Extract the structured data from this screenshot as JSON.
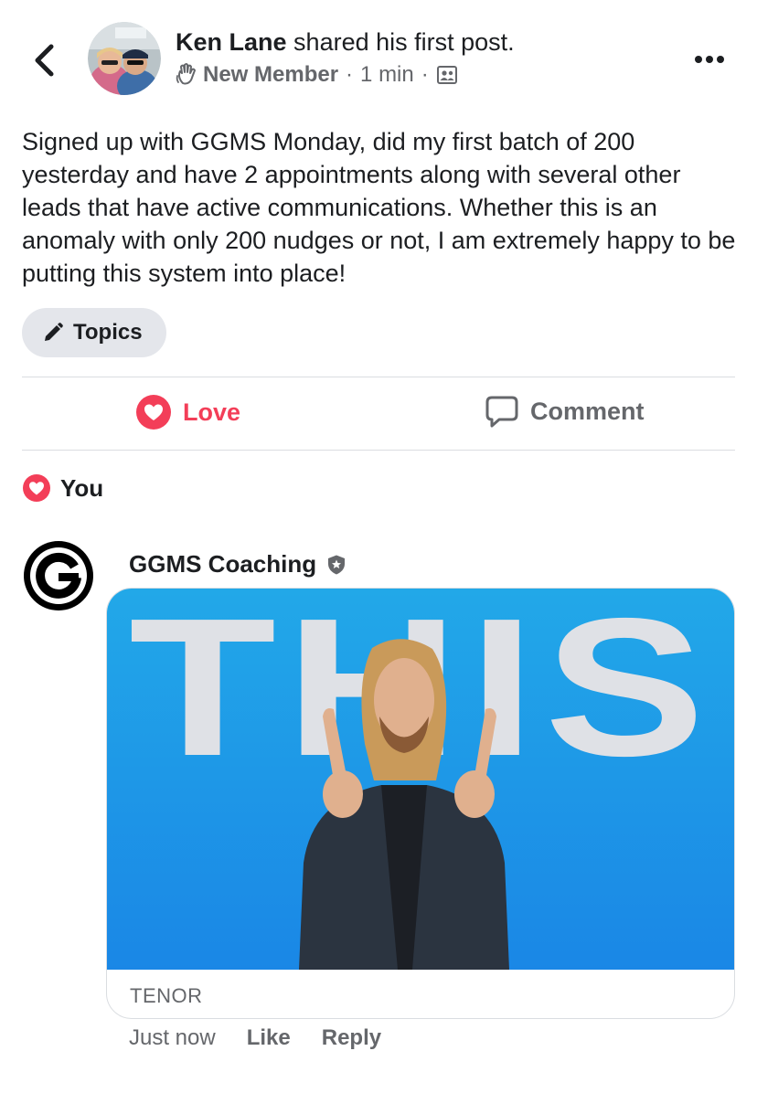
{
  "header": {
    "author_name": "Ken Lane",
    "author_action": "shared his first post.",
    "badge": "New Member",
    "time": "1 min",
    "icons": {
      "back": "chevron-left-icon",
      "badge": "waving-hand-icon",
      "audience": "group-audience-icon",
      "more": "more-dots-icon"
    }
  },
  "post": {
    "text": "Signed up with GGMS Monday, did my first batch of 200 yesterday and have 2 appointments along with several other leads that have active communications.  Whether this is an anomaly with only 200 nudges or not, I am extremely happy to be putting this system into place!",
    "topics_label": "Topics"
  },
  "actions": {
    "love_label": "Love",
    "comment_label": "Comment"
  },
  "reactions": {
    "summary": "You"
  },
  "comment": {
    "author": "GGMS Coaching",
    "gif_text": "THIS",
    "gif_source": "TENOR",
    "time": "Just now",
    "like_label": "Like",
    "reply_label": "Reply"
  },
  "colors": {
    "love": "#f33e58",
    "secondary_text": "#65676b",
    "gif_blue": "#1f9be6"
  }
}
